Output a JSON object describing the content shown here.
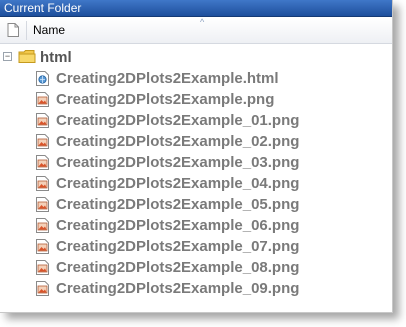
{
  "panel": {
    "title": "Current Folder",
    "column_header": "Name",
    "sort_indicator": "^"
  },
  "tree": {
    "folder": {
      "name": "html",
      "expanded": true,
      "expander_symbol": "−"
    },
    "files": [
      {
        "name": "Creating2DPlots2Example.html",
        "icon": "html-file-icon"
      },
      {
        "name": "Creating2DPlots2Example.png",
        "icon": "png-file-icon"
      },
      {
        "name": "Creating2DPlots2Example_01.png",
        "icon": "png-file-icon"
      },
      {
        "name": "Creating2DPlots2Example_02.png",
        "icon": "png-file-icon"
      },
      {
        "name": "Creating2DPlots2Example_03.png",
        "icon": "png-file-icon"
      },
      {
        "name": "Creating2DPlots2Example_04.png",
        "icon": "png-file-icon"
      },
      {
        "name": "Creating2DPlots2Example_05.png",
        "icon": "png-file-icon"
      },
      {
        "name": "Creating2DPlots2Example_06.png",
        "icon": "png-file-icon"
      },
      {
        "name": "Creating2DPlots2Example_07.png",
        "icon": "png-file-icon"
      },
      {
        "name": "Creating2DPlots2Example_08.png",
        "icon": "png-file-icon"
      },
      {
        "name": "Creating2DPlots2Example_09.png",
        "icon": "png-file-icon"
      }
    ]
  },
  "colors": {
    "titlebar": "#2a5fb0",
    "file_text": "#7a7a7a",
    "folder_yellow": "#f2c84b"
  }
}
